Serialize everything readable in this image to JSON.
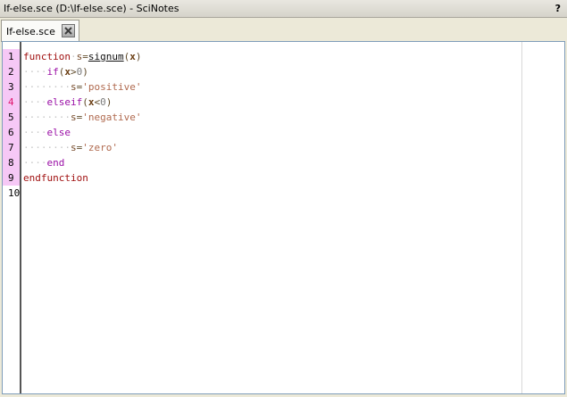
{
  "window": {
    "title": "If-else.sce (D:\\If-else.sce) - SciNotes",
    "help": "?"
  },
  "tab": {
    "label": "If-else.sce",
    "close_icon": "close-icon"
  },
  "gutter": {
    "line_numbers": [
      "1",
      "2",
      "3",
      "4",
      "5",
      "6",
      "7",
      "8",
      "9",
      "10"
    ]
  },
  "code": {
    "line1": {
      "kw": "function",
      "var": "s",
      "op": "=",
      "fn": "signum",
      "open": "(",
      "arg": "x",
      "close": ")"
    },
    "line2": {
      "dots": "····",
      "kw": "if",
      "open": "(",
      "arg": "x",
      "op": ">",
      "num": "0",
      "close": ")"
    },
    "line3": {
      "dots": "········",
      "var": "s",
      "op": "=",
      "str": "'positive'"
    },
    "line4": {
      "dots": "····",
      "kw": "elseif",
      "open": "(",
      "arg": "x",
      "op": "<",
      "num": "0",
      "close": ")"
    },
    "line5": {
      "dots": "········",
      "var": "s",
      "op": "=",
      "str": "'negative'"
    },
    "line6": {
      "dots": "····",
      "kw": "else"
    },
    "line7": {
      "dots": "········",
      "var": "s",
      "op": "=",
      "str": "'zero'"
    },
    "line8": {
      "dots": "····",
      "kw": "end"
    },
    "line9": {
      "kw": "endfunction"
    }
  }
}
